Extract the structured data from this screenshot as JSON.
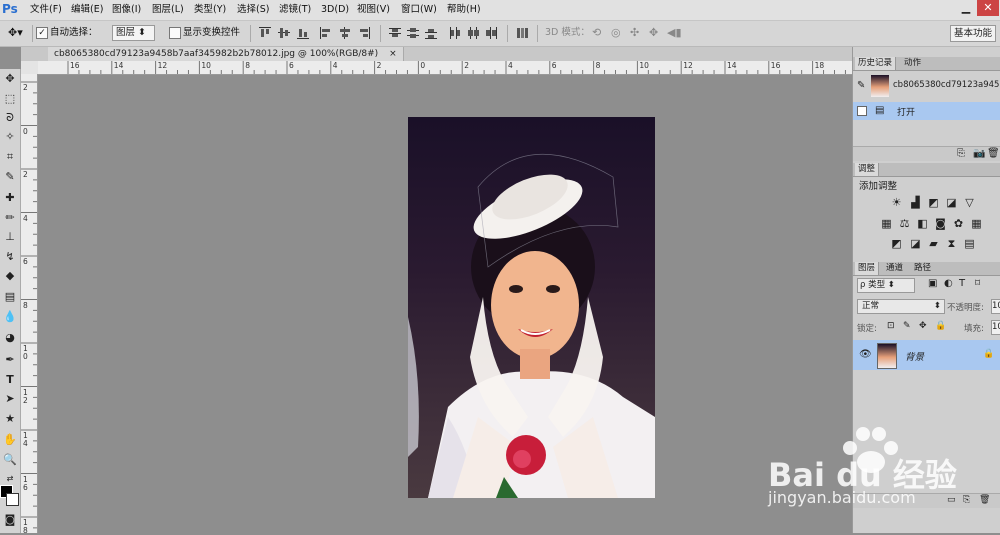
{
  "menubar": {
    "logo": "Ps",
    "items": [
      "文件(F)",
      "编辑(E)",
      "图像(I)",
      "图层(L)",
      "类型(Y)",
      "选择(S)",
      "滤镜(T)",
      "3D(D)",
      "视图(V)",
      "窗口(W)",
      "帮助(H)"
    ],
    "minimize": "▁",
    "close": "✕"
  },
  "optbar": {
    "auto_select_label": "自动选择：",
    "auto_select_checked": "✓",
    "auto_select_value": "图层",
    "show_transform_label": "显示变换控件",
    "mode_3d_label": "3D 模式：",
    "workspace": "基本功能"
  },
  "document": {
    "tab_title": "cb8065380cd79123a9458b7aaf345982b2b78012.jpg @ 100%(RGB/8#)",
    "tab_close": "×",
    "ruler_top": [
      "16",
      "14",
      "12",
      "10",
      "8",
      "6",
      "4",
      "2",
      "0",
      "2",
      "4",
      "6",
      "8",
      "10",
      "12",
      "14",
      "16",
      "18",
      "20"
    ],
    "ruler_left": [
      "2",
      "0",
      "2",
      "4",
      "6",
      "8",
      "10",
      "12",
      "14",
      "16",
      "18"
    ]
  },
  "history_panel": {
    "tabs": [
      "历史记录",
      "动作"
    ],
    "snapshot_name": "cb8065380cd79123a9458b7",
    "open_label": "打开"
  },
  "adjust_panel": {
    "tab": "调整",
    "title": "添加调整"
  },
  "layers_panel": {
    "tabs": [
      "图层",
      "通道",
      "路径"
    ],
    "filter_label": "ρ 类型",
    "blend_mode": "正常",
    "opacity_label": "不透明度:",
    "opacity_value": "10",
    "lock_label": "锁定:",
    "fill_label": "填充:",
    "fill_value": "10",
    "layer_name": "背景"
  },
  "watermark": {
    "brand": "Bai du 经验",
    "url": "jingyan.baidu.com"
  },
  "colors": {
    "accent": "#a9c8f0",
    "canvas": "#8e8e8e"
  }
}
